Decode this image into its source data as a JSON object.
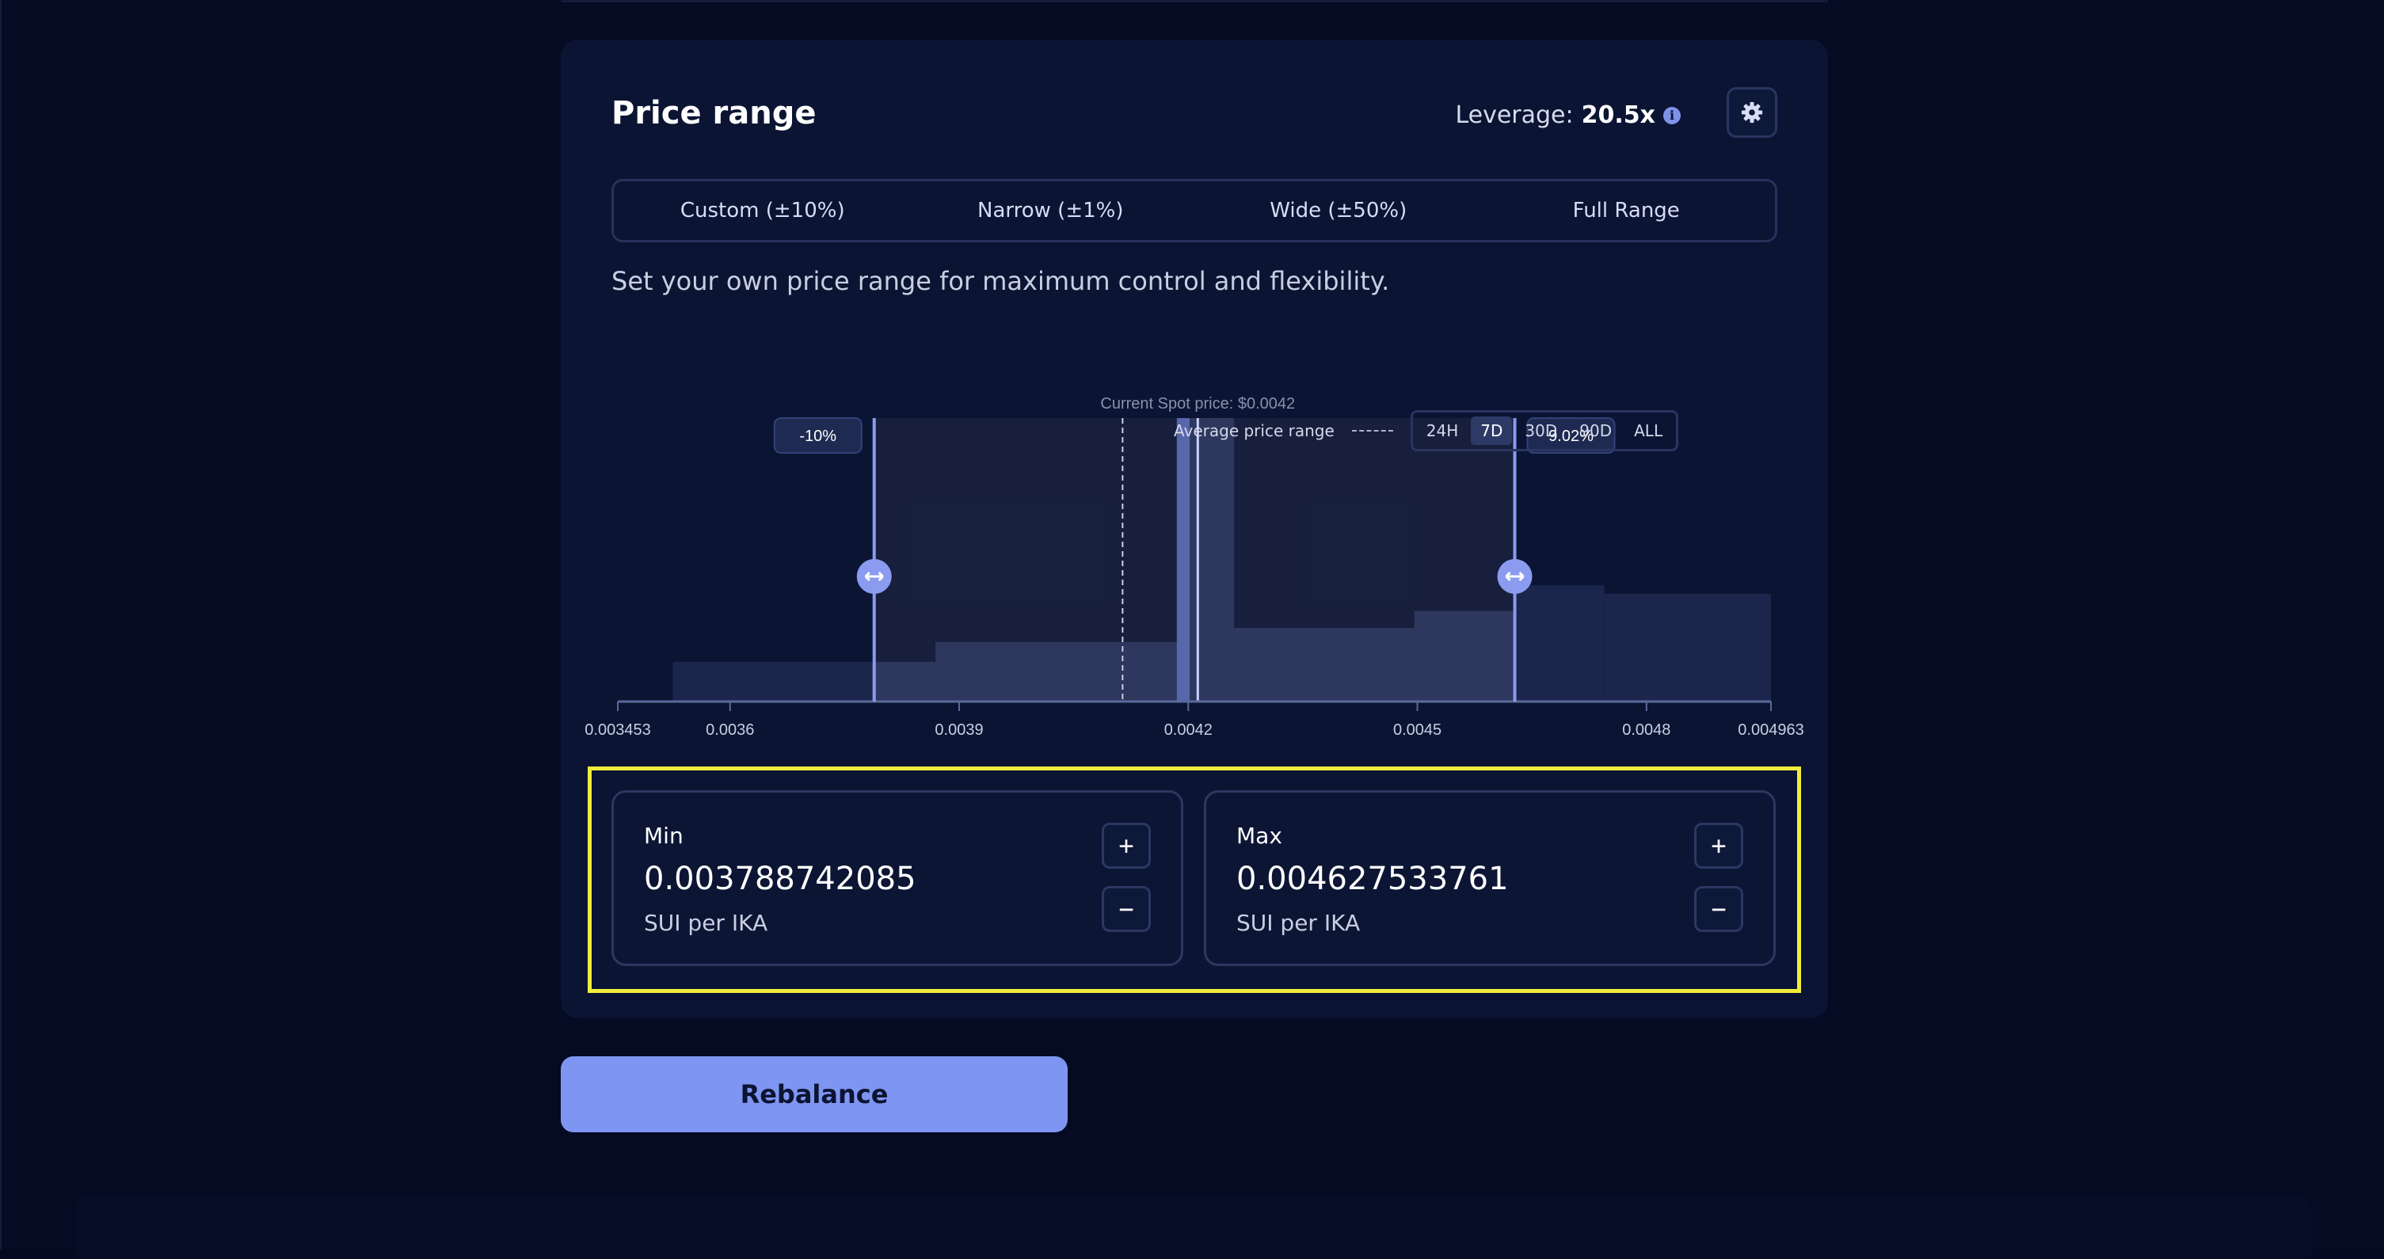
{
  "card": {
    "title": "Price range",
    "leverage_label": "Leverage:",
    "leverage_value": "20.5x",
    "description": "Set your own price range for maximum control and flexibility."
  },
  "tabs": [
    {
      "label": "Custom (±10%)",
      "active": true
    },
    {
      "label": "Narrow (±1%)",
      "active": false
    },
    {
      "label": "Wide (±50%)",
      "active": false
    },
    {
      "label": "Full Range",
      "active": false
    }
  ],
  "chart_data": {
    "type": "area",
    "spot_label": "Current Spot price: $0.0042",
    "current_price": 0.0042,
    "average_price": 0.004114,
    "x_min": 0.003453,
    "x_max": 0.004963,
    "x_ticks": [
      "0.003453",
      "0.0036",
      "0.0039",
      "0.0042",
      "0.0045",
      "0.0048",
      "0.004963"
    ],
    "x_tick_values": [
      0.003453,
      0.0036,
      0.0039,
      0.0042,
      0.0045,
      0.0048,
      0.004963
    ],
    "range_min": 0.003788742085,
    "range_max": 0.004627533761,
    "range_min_label": "-10%",
    "range_max_label": "9.02%",
    "liquidity_bins": [
      {
        "from": 0.003525,
        "to": 0.00379,
        "level": 0.14
      },
      {
        "from": 0.00379,
        "to": 0.003862,
        "level": 0.14
      },
      {
        "from": 0.003862,
        "to": 0.003869,
        "level": 0.14
      },
      {
        "from": 0.003869,
        "to": 0.004185,
        "level": 0.21
      },
      {
        "from": 0.004185,
        "to": 0.004202,
        "level": 1.0
      },
      {
        "from": 0.004202,
        "to": 0.00426,
        "level": 1.0
      },
      {
        "from": 0.00426,
        "to": 0.004496,
        "level": 0.26
      },
      {
        "from": 0.004496,
        "to": 0.004542,
        "level": 0.32
      },
      {
        "from": 0.004542,
        "to": 0.004627,
        "level": 0.32
      },
      {
        "from": 0.004627,
        "to": 0.004745,
        "level": 0.41
      },
      {
        "from": 0.004745,
        "to": 0.004835,
        "level": 0.38
      },
      {
        "from": 0.004835,
        "to": 0.004963,
        "level": 0.38
      }
    ],
    "current_bin": {
      "from": 0.004185,
      "to": 0.004202
    }
  },
  "interval": {
    "label": "Average price range",
    "options": [
      {
        "label": "24H",
        "active": false
      },
      {
        "label": "7D",
        "active": true
      },
      {
        "label": "30D",
        "active": false
      },
      {
        "label": "90D",
        "active": false
      },
      {
        "label": "ALL",
        "active": false
      }
    ]
  },
  "min": {
    "label": "Min",
    "value": "0.003788742085",
    "unit": "SUI per IKA",
    "plus": "+",
    "minus": "−"
  },
  "max": {
    "label": "Max",
    "value": "0.004627533761",
    "unit": "SUI per IKA",
    "plus": "+",
    "minus": "−"
  },
  "rebalance_label": "Rebalance",
  "colors": {
    "background": "#050b22",
    "card": "#0b1432",
    "accent": "#7f95f2",
    "bar": "#1c264c",
    "bar_in_range": "#232d55",
    "highlight": "#f2ed3c"
  }
}
